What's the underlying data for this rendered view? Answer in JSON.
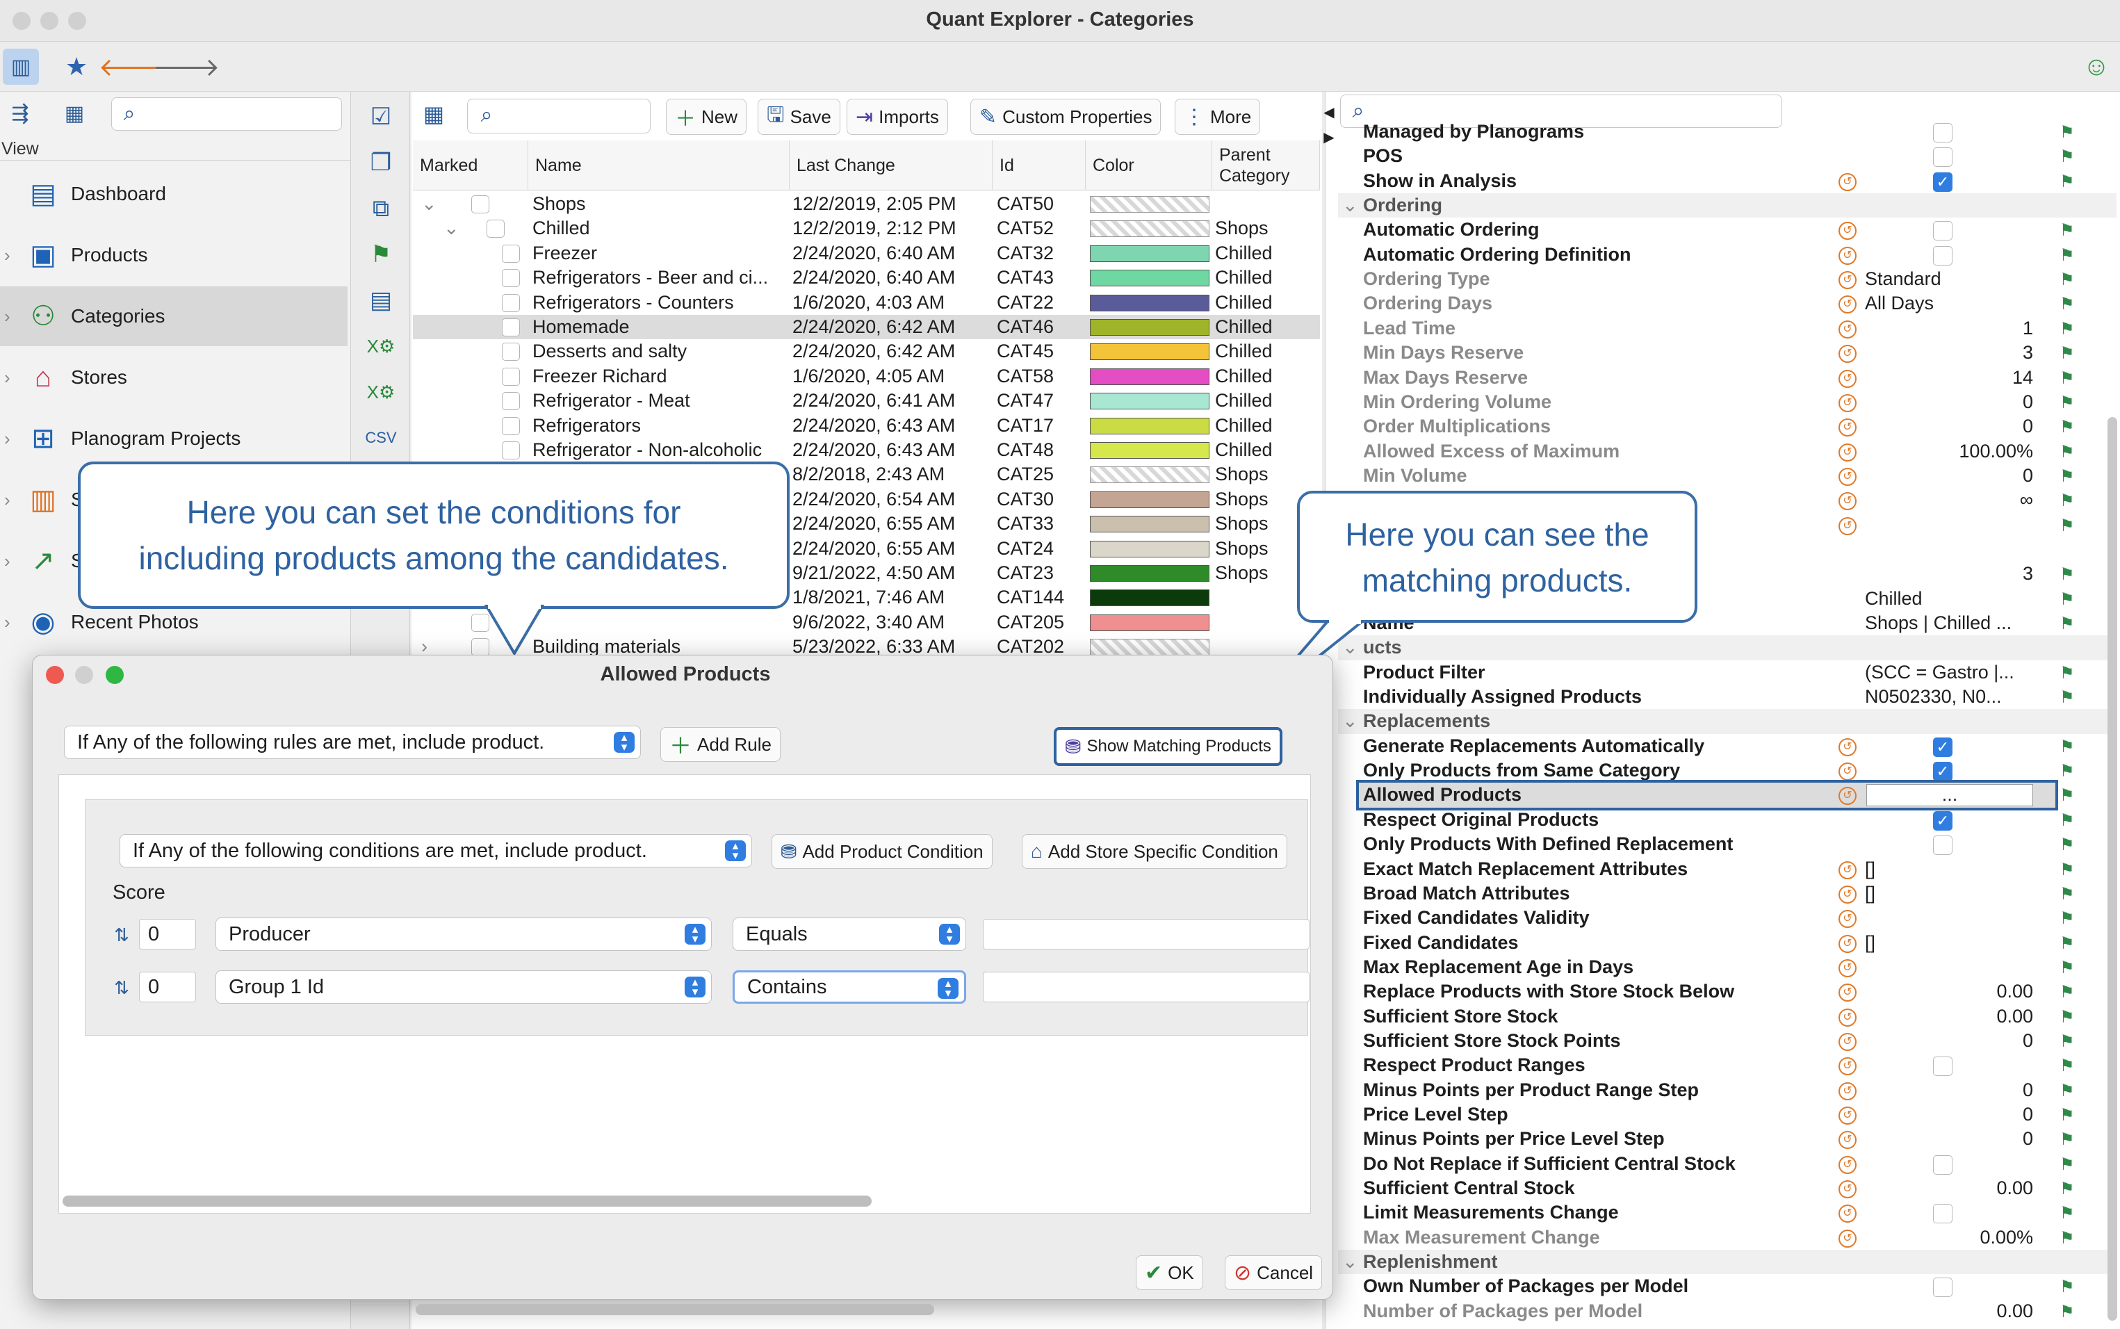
{
  "window": {
    "title": "Quant Explorer - Categories"
  },
  "left": {
    "view_label": "View",
    "items": [
      {
        "label": "Dashboard"
      },
      {
        "label": "Products"
      },
      {
        "label": "Categories"
      },
      {
        "label": "Stores"
      },
      {
        "label": "Planogram Projects"
      },
      {
        "label": "S"
      },
      {
        "label": "S"
      },
      {
        "label": "Recent Photos"
      }
    ]
  },
  "toolbar": {
    "new": "New",
    "save": "Save",
    "imports": "Imports",
    "custom": "Custom Properties",
    "more": "More"
  },
  "table": {
    "headers": {
      "marked": "Marked",
      "name": "Name",
      "last_change": "Last Change",
      "id": "Id",
      "color": "Color",
      "parent1": "Parent",
      "parent2": "Category"
    },
    "rows": [
      {
        "name": "Shops",
        "date": "12/2/2019, 2:05 PM",
        "id": "CAT50",
        "color": "pattern",
        "parent": ""
      },
      {
        "name": "Chilled",
        "date": "12/2/2019, 2:12 PM",
        "id": "CAT52",
        "color": "pattern",
        "parent": "Shops"
      },
      {
        "name": "Freezer",
        "date": "2/24/2020, 6:40 AM",
        "id": "CAT32",
        "color": "#7fd5b0",
        "parent": "Chilled"
      },
      {
        "name": "Refrigerators - Beer and ci...",
        "date": "2/24/2020, 6:40 AM",
        "id": "CAT43",
        "color": "#6fd8a2",
        "parent": "Chilled"
      },
      {
        "name": "Refrigerators - Counters",
        "date": "1/6/2020, 4:03 AM",
        "id": "CAT22",
        "color": "#5a5c9a",
        "parent": "Chilled"
      },
      {
        "name": "Homemade",
        "date": "2/24/2020, 6:42 AM",
        "id": "CAT46",
        "color": "#a0b42a",
        "parent": "Chilled"
      },
      {
        "name": "Desserts and salty",
        "date": "2/24/2020, 6:42 AM",
        "id": "CAT45",
        "color": "#f3c33a",
        "parent": "Chilled"
      },
      {
        "name": "Freezer Richard",
        "date": "1/6/2020, 4:05 AM",
        "id": "CAT58",
        "color": "#e44cc4",
        "parent": "Chilled"
      },
      {
        "name": "Refrigerator - Meat",
        "date": "2/24/2020, 6:41 AM",
        "id": "CAT47",
        "color": "#a8e8d2",
        "parent": "Chilled"
      },
      {
        "name": "Refrigerators",
        "date": "2/24/2020, 6:43 AM",
        "id": "CAT17",
        "color": "#cadb44",
        "parent": "Chilled"
      },
      {
        "name": "Refrigerator - Non-alcoholic",
        "date": "2/24/2020, 6:43 AM",
        "id": "CAT48",
        "color": "#d6e74c",
        "parent": "Chilled"
      },
      {
        "name": "",
        "date": "8/2/2018, 2:43 AM",
        "id": "CAT25",
        "color": "pattern",
        "parent": "Shops"
      },
      {
        "name": "",
        "date": "2/24/2020, 6:54 AM",
        "id": "CAT30",
        "color": "#c4a594",
        "parent": "Shops"
      },
      {
        "name": "",
        "date": "2/24/2020, 6:55 AM",
        "id": "CAT33",
        "color": "#cbbfae",
        "parent": "Shops"
      },
      {
        "name": "",
        "date": "2/24/2020, 6:55 AM",
        "id": "CAT24",
        "color": "#dad6c9",
        "parent": "Shops"
      },
      {
        "name": "",
        "date": "9/21/2022, 4:50 AM",
        "id": "CAT23",
        "color": "#2f8a2a",
        "parent": "Shops"
      },
      {
        "name": "",
        "date": "1/8/2021, 7:46 AM",
        "id": "CAT144",
        "color": "#0b3a0b",
        "parent": ""
      },
      {
        "name": "",
        "date": "9/6/2022, 3:40 AM",
        "id": "CAT205",
        "color": "#ef8f8f",
        "parent": ""
      },
      {
        "name": "Building materials",
        "date": "5/23/2022, 6:33 AM",
        "id": "CAT202",
        "color": "pattern",
        "parent": ""
      }
    ]
  },
  "props": {
    "rows": [
      {
        "label": "Managed by Planograms",
        "type": "check",
        "checked": false
      },
      {
        "label": "POS",
        "type": "check",
        "checked": false
      },
      {
        "label": "Show in Analysis",
        "type": "check",
        "checked": true,
        "icon": true
      },
      {
        "label": "Ordering",
        "type": "group"
      },
      {
        "label": "Automatic Ordering",
        "type": "check",
        "checked": false,
        "icon": true
      },
      {
        "label": "Automatic Ordering Definition",
        "type": "check",
        "checked": false,
        "icon": true
      },
      {
        "label": "Ordering Type",
        "type": "text",
        "value": "Standard",
        "gray": true,
        "icon": true
      },
      {
        "label": "Ordering Days",
        "type": "text",
        "value": "All Days",
        "gray": true,
        "icon": true
      },
      {
        "label": "Lead Time",
        "type": "num",
        "value": "1",
        "gray": true,
        "icon": true
      },
      {
        "label": "Min Days Reserve",
        "type": "num",
        "value": "3",
        "gray": true,
        "icon": true
      },
      {
        "label": "Max Days Reserve",
        "type": "num",
        "value": "14",
        "gray": true,
        "icon": true
      },
      {
        "label": "Min Ordering Volume",
        "type": "num",
        "value": "0",
        "gray": true,
        "icon": true
      },
      {
        "label": "Order Multiplications",
        "type": "num",
        "value": "0",
        "gray": true,
        "icon": true
      },
      {
        "label": "Allowed Excess of Maximum",
        "type": "num",
        "value": "100.00%",
        "gray": true,
        "icon": true
      },
      {
        "label": "Min Volume",
        "type": "num",
        "value": "0",
        "gray": true,
        "icon": true
      },
      {
        "label": "",
        "type": "num",
        "value": "∞",
        "icon": true
      },
      {
        "label": "",
        "type": "blank",
        "icon": true
      },
      {
        "label": "",
        "type": "blank2"
      },
      {
        "label": "",
        "type": "num",
        "value": "3"
      },
      {
        "label": "",
        "type": "text",
        "value": "Chilled"
      },
      {
        "label": "Name",
        "type": "text",
        "value": "Shops | Chilled ..."
      },
      {
        "label": "ucts",
        "type": "group"
      },
      {
        "label": "Product Filter",
        "type": "text",
        "value": "(SCC = Gastro |..."
      },
      {
        "label": "Individually Assigned Products",
        "type": "text",
        "value": "N0502330, N0..."
      },
      {
        "label": "Replacements",
        "type": "group"
      },
      {
        "label": "Generate Replacements Automatically",
        "type": "check",
        "checked": true,
        "icon": true
      },
      {
        "label": "Only Products from Same Category",
        "type": "check",
        "checked": true,
        "icon": true
      },
      {
        "label": "Allowed Products",
        "type": "dots",
        "value": "...",
        "icon": true,
        "highlight": true
      },
      {
        "label": "Respect Original Products",
        "type": "check",
        "checked": true
      },
      {
        "label": "Only Products With Defined Replacement",
        "type": "check",
        "checked": false
      },
      {
        "label": "Exact Match Replacement Attributes",
        "type": "text",
        "value": "[]",
        "icon": true
      },
      {
        "label": "Broad Match Attributes",
        "type": "text",
        "value": "[]",
        "icon": true
      },
      {
        "label": "Fixed Candidates Validity",
        "type": "blank",
        "icon": true
      },
      {
        "label": "Fixed Candidates",
        "type": "text",
        "value": "[]",
        "icon": true
      },
      {
        "label": "Max Replacement Age in Days",
        "type": "blank",
        "icon": true
      },
      {
        "label": "Replace Products with Store Stock Below",
        "type": "num",
        "value": "0.00",
        "icon": true
      },
      {
        "label": "Sufficient Store Stock",
        "type": "num",
        "value": "0.00",
        "icon": true
      },
      {
        "label": "Sufficient Store Stock Points",
        "type": "num",
        "value": "0",
        "icon": true
      },
      {
        "label": "Respect Product Ranges",
        "type": "check",
        "checked": false,
        "icon": true
      },
      {
        "label": "Minus Points per Product Range Step",
        "type": "num",
        "value": "0",
        "icon": true
      },
      {
        "label": "Price Level Step",
        "type": "num",
        "value": "0",
        "icon": true
      },
      {
        "label": "Minus Points per Price Level Step",
        "type": "num",
        "value": "0",
        "icon": true
      },
      {
        "label": "Do Not Replace if Sufficient Central Stock",
        "type": "check",
        "checked": false,
        "icon": true
      },
      {
        "label": "Sufficient Central Stock",
        "type": "num",
        "value": "0.00",
        "icon": true
      },
      {
        "label": "Limit Measurements Change",
        "type": "check",
        "checked": false,
        "icon": true
      },
      {
        "label": "Max Measurement Change",
        "type": "num",
        "value": "0.00%",
        "gray": true,
        "icon": true
      },
      {
        "label": "Replenishment",
        "type": "group"
      },
      {
        "label": "Own Number of Packages per Model",
        "type": "check",
        "checked": false
      },
      {
        "label": "Number of Packages per Model",
        "type": "num",
        "value": "0.00",
        "gray": true
      }
    ]
  },
  "callouts": {
    "left_line1": "Here you can set the conditions for",
    "left_line2": "including products among the candidates.",
    "right_line1": "Here you can see the",
    "right_line2": "matching products."
  },
  "dialog": {
    "title": "Allowed Products",
    "rule_select": "If Any of the following rules are met, include product.",
    "add_rule": "Add Rule",
    "show_matching": "Show Matching Products",
    "cond_select": "If Any of the following conditions are met, include product.",
    "add_product_condition": "Add Product Condition",
    "add_store_condition": "Add Store Specific Condition",
    "score_label": "Score",
    "conditions": [
      {
        "score": "0",
        "field": "Producer",
        "op": "Equals",
        "value": ""
      },
      {
        "score": "0",
        "field": "Group 1 Id",
        "op": "Contains",
        "value": ""
      }
    ],
    "ok": "OK",
    "cancel": "Cancel"
  }
}
